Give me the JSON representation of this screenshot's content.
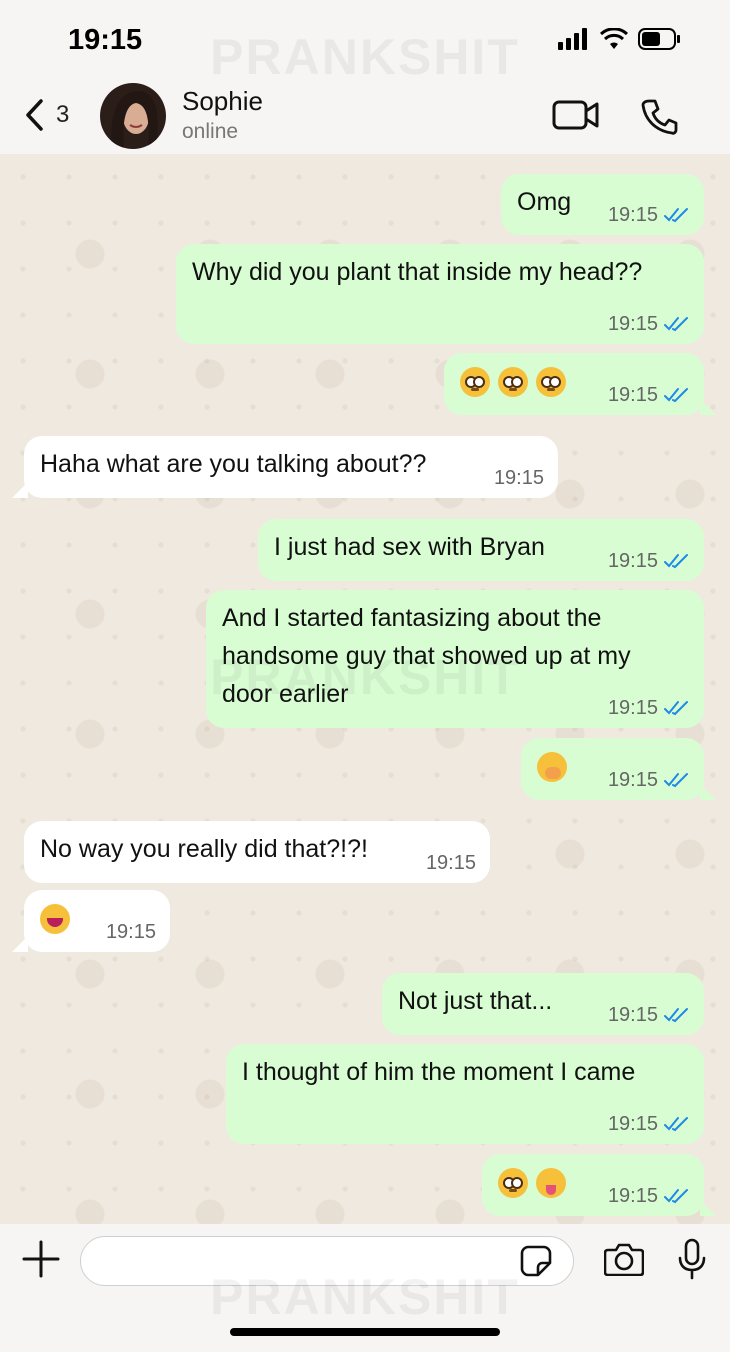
{
  "status_bar": {
    "time": "19:15"
  },
  "watermark": "PRANKSHIT",
  "header": {
    "back_count": "3",
    "contact_name": "Sophie",
    "contact_status": "online"
  },
  "messages": [
    {
      "dir": "out",
      "text": "Omg",
      "time": "19:15"
    },
    {
      "dir": "out",
      "text": "Why did you plant that inside my head??",
      "time": "19:15"
    },
    {
      "dir": "out",
      "emojis": [
        "flushed",
        "flushed",
        "flushed"
      ],
      "time": "19:15"
    },
    {
      "dir": "in",
      "text": "Haha what are you talking about??",
      "time": "19:15"
    },
    {
      "dir": "out",
      "text": "I just had sex with Bryan",
      "time": "19:15"
    },
    {
      "dir": "out",
      "lines": [
        "And I started fantasizing about the",
        "handsome guy that showed up at my",
        "door earlier"
      ],
      "time": "19:15"
    },
    {
      "dir": "out",
      "emojis": [
        "hand-over-mouth"
      ],
      "time": "19:15"
    },
    {
      "dir": "in",
      "text": "No way you really did that?!?!",
      "time": "19:15"
    },
    {
      "dir": "in",
      "emojis": [
        "squinting-tongue"
      ],
      "time": "19:15"
    },
    {
      "dir": "out",
      "text": "Not just that...",
      "time": "19:15"
    },
    {
      "dir": "out",
      "text": "I thought of him the moment I came",
      "time": "19:15"
    },
    {
      "dir": "out",
      "emojis": [
        "flushed",
        "winking-tongue"
      ],
      "time": "19:15"
    }
  ],
  "input": {
    "value": ""
  },
  "colors": {
    "outgoing": "#d9fdd3",
    "incoming": "#ffffff",
    "read_ticks": "#1c8ae6",
    "chat_bg": "#efe9df"
  }
}
